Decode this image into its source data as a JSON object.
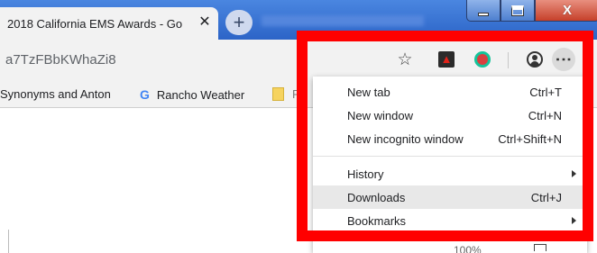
{
  "tab": {
    "title": "2018 California EMS Awards - Go",
    "close_glyph": "✕"
  },
  "new_tab_glyph": "+",
  "window_controls": {
    "minimize": "minimize-icon",
    "maximize": "maximize-icon",
    "close_glyph": "X"
  },
  "toolbar": {
    "url_fragment": "a7TzFBbKWhaZi8",
    "bookmark_star": "☆",
    "pdf_glyph": "▲",
    "menu_dots": "⋮"
  },
  "bookmarks": {
    "items": [
      {
        "label": "Synonyms and Anton"
      },
      {
        "label": "Rancho Weather",
        "icon_glyph": "G"
      }
    ],
    "partial": "Re"
  },
  "menu": {
    "items": [
      {
        "label": "New tab",
        "shortcut": "Ctrl+T"
      },
      {
        "label": "New window",
        "shortcut": "Ctrl+N"
      },
      {
        "label": "New incognito window",
        "shortcut": "Ctrl+Shift+N"
      },
      {
        "label": "History",
        "shortcut": ""
      },
      {
        "label": "Downloads",
        "shortcut": "Ctrl+J"
      },
      {
        "label": "Bookmarks",
        "shortcut": ""
      }
    ],
    "highlighted": "Downloads",
    "zoom_partial": "100%"
  },
  "colors": {
    "highlight_frame": "#ff0000",
    "titlebar": "#2c64c7",
    "menu_hover": "#e8e8e8"
  }
}
